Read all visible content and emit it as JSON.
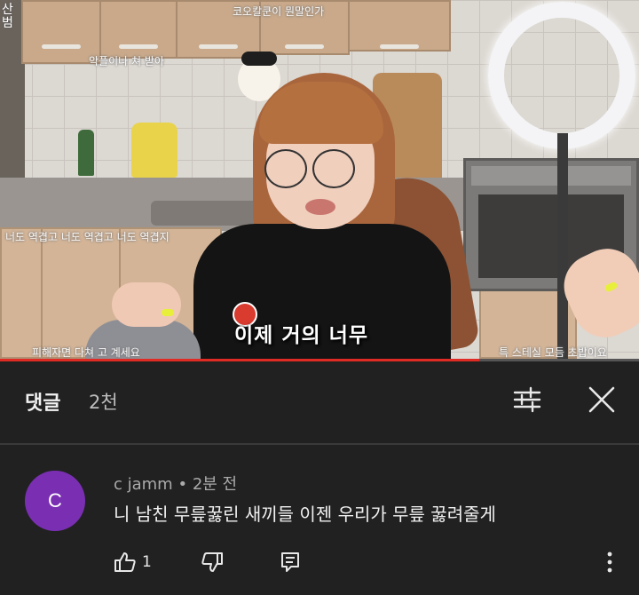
{
  "video": {
    "side_caption": "산범",
    "overlay_top_center": "코오칼쿤이 뭔말인가",
    "overlay_top_left": "악플이나 쳐 받아",
    "overlay_mid_left": "너도 역겹고 너도 역겹고 너도 역겹지",
    "overlay_bottom_left": "피해자면 다쳐 고 계세요",
    "overlay_bottom_right": "특 스테실 모듬 초밥이요",
    "subtitle": "이제 거의 너무",
    "progress_fraction": 0.75,
    "progress_color": "#e02a24"
  },
  "comments_header": {
    "title": "댓글",
    "count": "2천",
    "sort_icon": "sort-filter-icon",
    "close_icon": "close-icon"
  },
  "comment": {
    "avatar_letter": "C",
    "avatar_color": "#7a2fb3",
    "author": "c jamm",
    "separator": "•",
    "time": "2분 전",
    "text": "니 남친 무릎꿇린 새끼들 이젠 우리가 무릎 꿇려줄게",
    "like_count": "1",
    "icons": [
      "thumbs-up-icon",
      "thumbs-down-icon",
      "reply-icon",
      "more-vert-icon"
    ]
  }
}
